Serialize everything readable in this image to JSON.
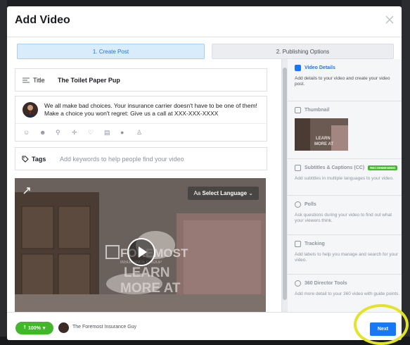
{
  "dialog": {
    "title": "Add Video"
  },
  "steps": [
    {
      "label": "1. Create Post",
      "active": true
    },
    {
      "label": "2. Publishing Options",
      "active": false
    }
  ],
  "post": {
    "title_label": "Title",
    "title_value": "The Toilet Paper Pup",
    "description": "We all make bad choices. Your insurance carrier doesn't have to be one of them! Make a choice you won't regret: Give us a call at XXX-XXX-XXXX",
    "description_icons": [
      "tag-people-icon",
      "emoji-icon",
      "location-icon",
      "crosshair-icon",
      "heart-icon",
      "building-icon",
      "chat-icon",
      "people-icon"
    ],
    "tags_label": "Tags",
    "tags_placeholder": "Add keywords to help people find your video"
  },
  "video": {
    "language_button": "Select Language",
    "language_prefix": "Aa"
  },
  "right_panel": {
    "sections": [
      {
        "title": "Video Details",
        "desc": "Add details to your video and create your video post.",
        "icon": "video-details-icon",
        "active": true
      },
      {
        "title": "Thumbnail",
        "desc": "",
        "icon": "thumbnail-icon",
        "active": false
      },
      {
        "title": "Subtitles & Captions (CC)",
        "badge": "RECOMMENDED",
        "desc": "Add subtitles in multiple languages to your video.",
        "icon": "captions-icon",
        "active": false
      },
      {
        "title": "Polls",
        "desc": "Ask questions during your video to find out what your viewers think.",
        "icon": "polls-icon",
        "active": false
      },
      {
        "title": "Tracking",
        "desc": "Add labels to help you manage and search for your video.",
        "icon": "tracking-icon",
        "active": false
      },
      {
        "title": "360 Director Tools",
        "desc": "Add more detail to your 360 video with guide points.",
        "icon": "360-icon",
        "active": false
      }
    ]
  },
  "footer": {
    "privacy_label": "100%",
    "page_name": "The Foremost Insurance Guy",
    "next_label": "Next"
  },
  "colors": {
    "accent": "#1877f2",
    "success": "#42b72a",
    "highlight": "#e3e328"
  }
}
